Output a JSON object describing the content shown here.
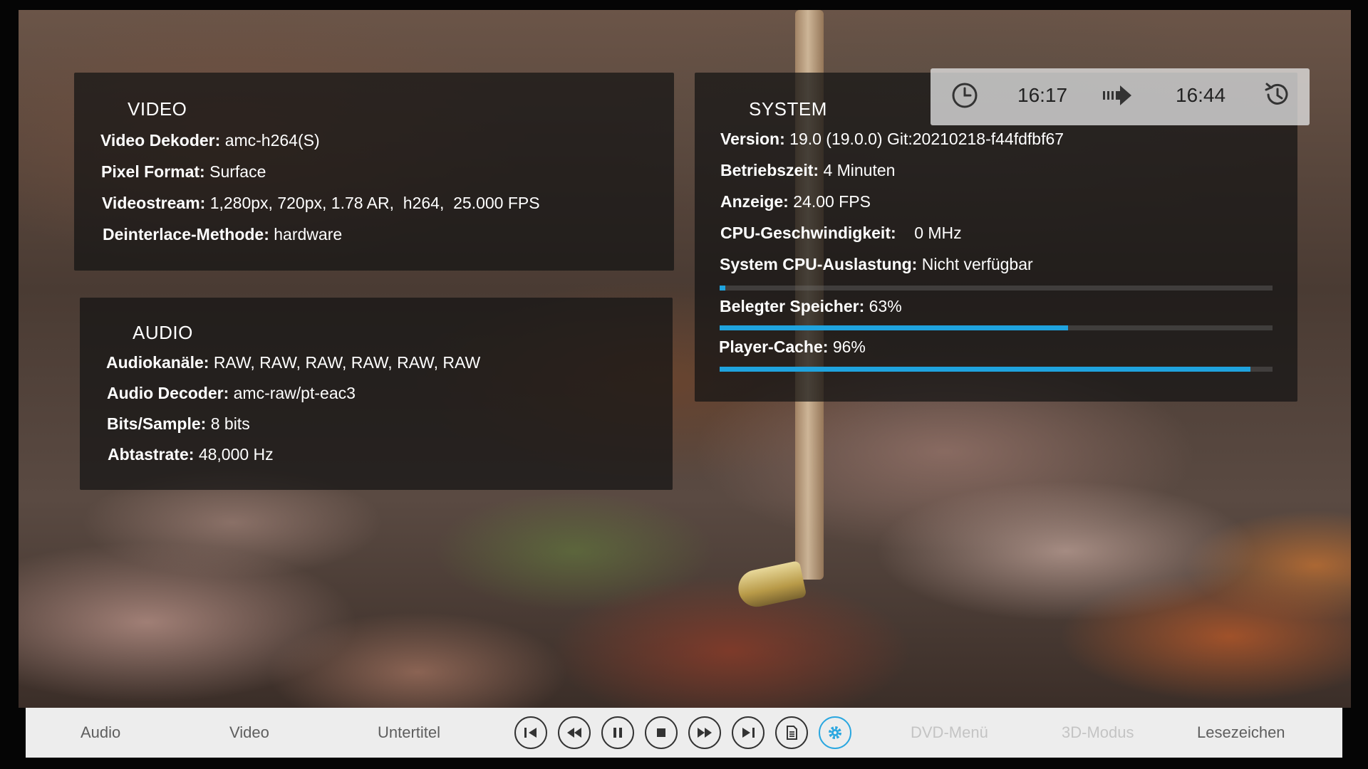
{
  "video": {
    "title": "VIDEO",
    "rows": [
      {
        "key": "Video Dekoder:",
        "value": "amc-h264(S)"
      },
      {
        "key": "Pixel Format:",
        "value": "Surface"
      },
      {
        "key": "Videostream:",
        "value": "1,280px, 720px, 1.78 AR,  h264,  25.000 FPS"
      },
      {
        "key": "Deinterlace-Methode:",
        "value": "hardware"
      }
    ]
  },
  "audio": {
    "title": "AUDIO",
    "rows": [
      {
        "key": "Audiokanäle:",
        "value": "RAW, RAW, RAW, RAW, RAW, RAW"
      },
      {
        "key": "Audio Decoder:",
        "value": "amc-raw/pt-eac3"
      },
      {
        "key": "Bits/Sample:",
        "value": "8 bits"
      },
      {
        "key": "Abtastrate:",
        "value": "48,000 Hz"
      }
    ]
  },
  "system": {
    "title": "SYSTEM",
    "rows": [
      {
        "key": "Version:",
        "value": "19.0 (19.0.0) Git:20210218-f44fdfbf67"
      },
      {
        "key": "Betriebszeit:",
        "value": "4 Minuten"
      },
      {
        "key": "Anzeige:",
        "value": "24.00 FPS"
      },
      {
        "key": "CPU-Geschwindigkeit:",
        "value": "   0 MHz"
      },
      {
        "key": "System CPU-Auslastung:",
        "value": "Nicht verfügbar"
      }
    ],
    "cpu_bar_fraction": 0.01,
    "memory": {
      "key": "Belegter Speicher:",
      "value": "63%",
      "fraction": 0.63
    },
    "cache": {
      "key": "Player-Cache:",
      "value": "96%",
      "fraction": 0.96
    },
    "accent_color": "#1fa3de"
  },
  "time": {
    "current": "16:17",
    "end": "16:44",
    "icons": [
      "clock-icon",
      "arrow-right-icon",
      "history-icon"
    ]
  },
  "osd": {
    "left_labels": [
      "Audio",
      "Video",
      "Untertitel"
    ],
    "controls": [
      "skip-previous-icon",
      "rewind-icon",
      "pause-icon",
      "stop-icon",
      "fast-forward-icon",
      "skip-next-icon",
      "playlist-icon",
      "settings-icon"
    ],
    "right_labels": [
      {
        "label": "DVD-Menü",
        "enabled": false
      },
      {
        "label": "3D-Modus",
        "enabled": false
      },
      {
        "label": "Lesezeichen",
        "enabled": true
      }
    ],
    "active_control": "settings-icon",
    "active_color": "#2aa7e0"
  }
}
